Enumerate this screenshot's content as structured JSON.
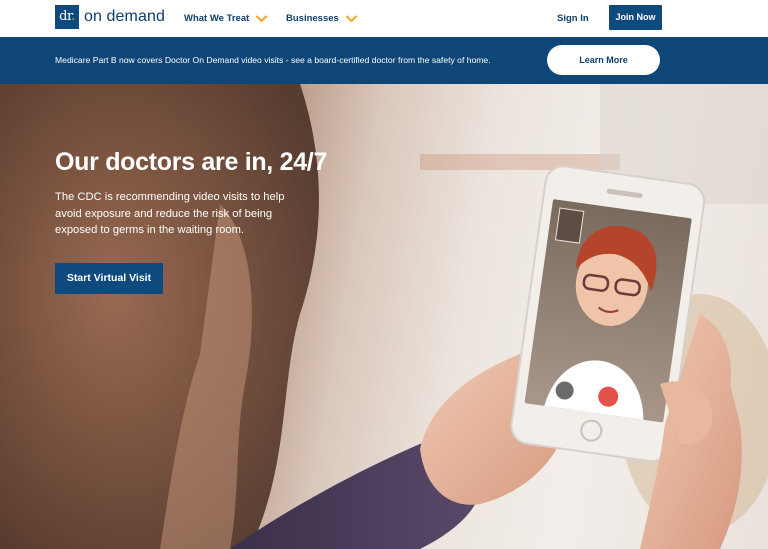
{
  "header": {
    "logo": {
      "mark": "dr",
      "wordmark": "on demand"
    },
    "nav": [
      {
        "label": "What We Treat"
      },
      {
        "label": "Businesses"
      }
    ],
    "sign_in_label": "Sign In",
    "join_now_label": "Join Now"
  },
  "announcement": {
    "text": "Medicare Part B now covers Doctor On Demand video visits - see a board-certified doctor from the safety of home.",
    "button_label": "Learn More"
  },
  "hero": {
    "title": "Our doctors are in, 24/7",
    "description": "The CDC is recommending video visits to help avoid exposure and reduce the risk of being exposed to germs in the waiting room.",
    "cta_label": "Start Virtual Visit"
  },
  "colors": {
    "brand_navy": "#0f4a7e",
    "accent_orange": "#f5a623",
    "white": "#ffffff"
  }
}
